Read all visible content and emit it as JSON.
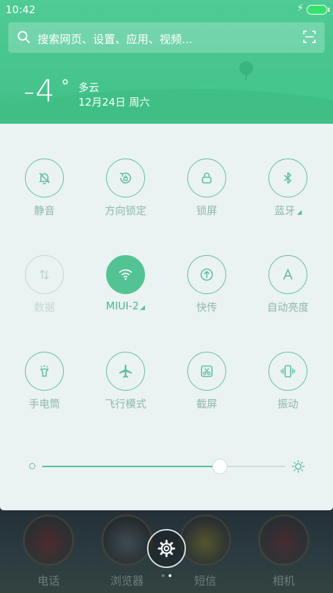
{
  "status_bar": {
    "time": "10:42"
  },
  "search": {
    "placeholder": "搜索网页、设置、应用、视频..."
  },
  "weather": {
    "temperature": "-4",
    "degree": "°",
    "condition": "多云",
    "date": "12月24日 周六"
  },
  "toggles": [
    {
      "label": "静音",
      "icon": "bell-off-icon",
      "state": "off"
    },
    {
      "label": "方向锁定",
      "icon": "rotation-lock-icon",
      "state": "off"
    },
    {
      "label": "锁屏",
      "icon": "lock-icon",
      "state": "off"
    },
    {
      "label": "蓝牙",
      "icon": "bluetooth-icon",
      "state": "off",
      "has_more": true
    },
    {
      "label": "数据",
      "icon": "data-icon",
      "state": "disabled"
    },
    {
      "label": "MIUI-2",
      "icon": "wifi-icon",
      "state": "on",
      "has_more": true
    },
    {
      "label": "快传",
      "icon": "upload-icon",
      "state": "off"
    },
    {
      "label": "自动亮度",
      "icon": "auto-brightness-icon",
      "state": "off"
    },
    {
      "label": "手电筒",
      "icon": "flashlight-icon",
      "state": "off"
    },
    {
      "label": "飞行模式",
      "icon": "airplane-icon",
      "state": "off"
    },
    {
      "label": "截屏",
      "icon": "screenshot-icon",
      "state": "off"
    },
    {
      "label": "振动",
      "icon": "vibrate-icon",
      "state": "off"
    }
  ],
  "brightness": {
    "level": 0.73
  },
  "dock": {
    "apps": [
      {
        "label": "电话"
      },
      {
        "label": "浏览器"
      },
      {
        "label": "短信"
      },
      {
        "label": "相机"
      }
    ]
  },
  "page_indicator": {
    "count": 2,
    "active": 1
  },
  "colors": {
    "accent": "#53c393",
    "header": "#4fcb95",
    "panel": "#ebf2f2"
  }
}
